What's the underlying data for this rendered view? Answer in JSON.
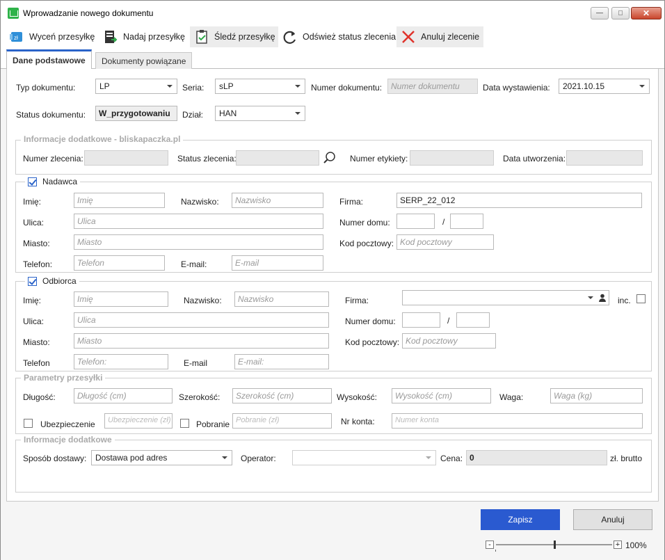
{
  "window": {
    "title": "Wprowadzanie nowego dokumentu",
    "minimize": "—",
    "maximize": "□",
    "close": "✕"
  },
  "toolbar": {
    "price": "Wyceń przesyłkę",
    "send": "Nadaj przesyłkę",
    "track": "Śledź przesyłkę",
    "refresh": "Odśwież status zlecenia",
    "cancel": "Anuluj zlecenie"
  },
  "tabs": [
    "Dane podstawowe",
    "Dokumenty powiązane"
  ],
  "doc": {
    "type_label": "Typ dokumentu:",
    "type_value": "LP",
    "series_label": "Seria:",
    "series_value": "sLP",
    "number_label": "Numer dokumentu:",
    "number_placeholder": "Numer dokumentu",
    "date_label": "Data wystawienia:",
    "date_value": "2021.10.15",
    "status_label": "Status dokumentu:",
    "status_value": "W_przygotowaniu",
    "dept_label": "Dział:",
    "dept_value": "HAN"
  },
  "info": {
    "legend": "Informacje dodatkowe - bliskapaczka.pl",
    "order_no": "Numer zlecenia:",
    "order_status": "Status zlecenia:",
    "label_no": "Numer etykiety:",
    "created": "Data utworzenia:"
  },
  "sender": {
    "legend": "Nadawca",
    "first_label": "Imię:",
    "first_ph": "Imię",
    "last_label": "Nazwisko:",
    "last_ph": "Nazwisko",
    "company_label": "Firma:",
    "company_value": "SERP_22_012",
    "street_label": "Ulica:",
    "street_ph": "Ulica",
    "house_label": "Numer domu:",
    "slash": "/",
    "city_label": "Miasto:",
    "city_ph": "Miasto",
    "zip_label": "Kod pocztowy:",
    "zip_ph": "Kod pocztowy",
    "phone_label": "Telefon:",
    "phone_ph": "Telefon",
    "email_label": "E-mail:",
    "email_ph": "E-mail"
  },
  "recipient": {
    "legend": "Odbiorca",
    "first_label": "Imię:",
    "first_ph": "Imię",
    "last_label": "Nazwisko:",
    "last_ph": "Nazwisko",
    "company_label": "Firma:",
    "inc_label": "inc.",
    "street_label": "Ulica:",
    "street_ph": "Ulica",
    "house_label": "Numer domu:",
    "slash": "/",
    "city_label": "Miasto:",
    "city_ph": "Miasto",
    "zip_label": "Kod pocztowy:",
    "zip_ph": "Kod pocztowy",
    "phone_label": "Telefon",
    "phone_ph": "Telefon:",
    "email_label": "E-mail",
    "email_ph": "E-mail:"
  },
  "params": {
    "legend": "Parametry przesyłki",
    "length_label": "Długość:",
    "length_ph": "Długość (cm)",
    "width_label": "Szerokość:",
    "width_ph": "Szerokość (cm)",
    "height_label": "Wysokość:",
    "height_ph": "Wysokość (cm)",
    "weight_label": "Waga:",
    "weight_ph": "Waga (kg)",
    "insurance_label": "Ubezpieczenie",
    "insurance_ph": "Ubezpieczenie (zł)",
    "cod_label": "Pobranie",
    "cod_ph": "Pobranie (zł)",
    "account_label": "Nr konta:",
    "account_ph": "Numer konta"
  },
  "extra": {
    "legend": "Informacje dodatkowe",
    "delivery_label": "Sposób dostawy:",
    "delivery_value": "Dostawa pod adres",
    "operator_label": "Operator:",
    "price_label": "Cena:",
    "price_value": "0",
    "price_unit": "zł. brutto"
  },
  "buttons": {
    "save": "Zapisz",
    "cancel": "Anuluj"
  },
  "zoom": {
    "minus": "-",
    "plus": "+",
    "level": "100%",
    "value_percent": 100
  }
}
